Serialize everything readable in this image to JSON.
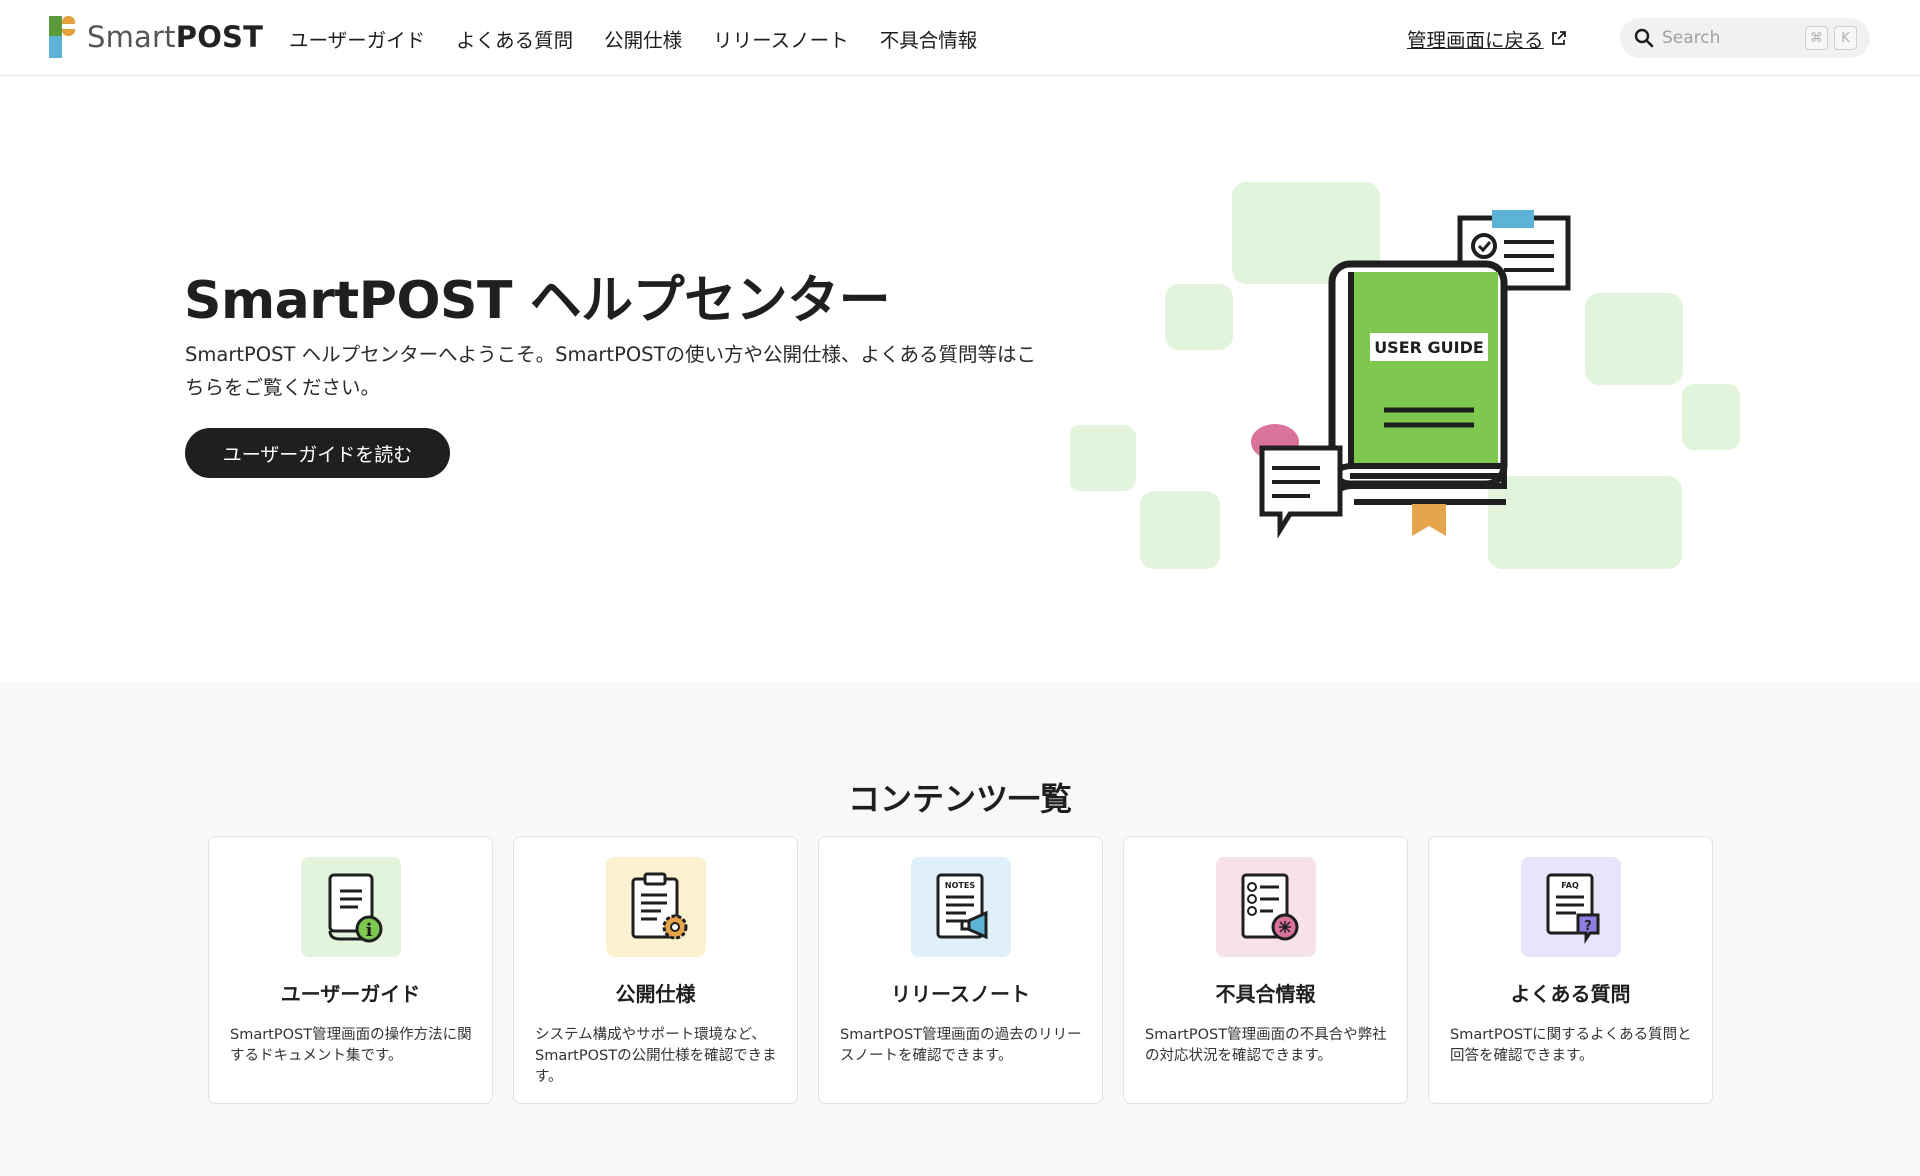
{
  "header": {
    "logo_light": "Smart",
    "logo_bold": "POST",
    "nav": [
      {
        "label": "ユーザーガイド"
      },
      {
        "label": "よくある質問"
      },
      {
        "label": "公開仕様"
      },
      {
        "label": "リリースノート"
      },
      {
        "label": "不具合情報"
      }
    ],
    "admin_link": "管理画面に戻る",
    "search": {
      "placeholder": "Search",
      "shortcut_modifier": "⌘",
      "shortcut_key": "K"
    }
  },
  "hero": {
    "title": "SmartPOST ヘルプセンター",
    "description": "SmartPOST ヘルプセンターへようこそ。SmartPOSTの使い方や公開仕様、よくある質問等はこちらをご覧ください。",
    "button_label": "ユーザーガイドを読む",
    "illustration_text": "USER GUIDE"
  },
  "contents": {
    "title": "コンテンツ一覧",
    "cards": [
      {
        "title": "ユーザーガイド",
        "description": "SmartPOST管理画面の操作方法に関するドキュメント集です。",
        "icon": "user-guide-book-icon",
        "color": "#e3f4dc"
      },
      {
        "title": "公開仕様",
        "description": "システム構成やサポート環境など、SmartPOSTの公開仕様を確認できます。",
        "icon": "spec-clipboard-gear-icon",
        "color": "#fcf2d2"
      },
      {
        "title": "リリースノート",
        "description": "SmartPOST管理画面の過去のリリースノートを確認できます。",
        "icon": "release-notes-megaphone-icon",
        "color": "#dff0fa"
      },
      {
        "title": "不具合情報",
        "description": "SmartPOST管理画面の不具合や弊社の対応状況を確認できます。",
        "icon": "bug-checklist-icon",
        "color": "#f7e1ea"
      },
      {
        "title": "よくある質問",
        "description": "SmartPOSTに関するよくある質問と回答を確認できます。",
        "icon": "faq-question-icon",
        "color": "#e6e5fb"
      }
    ]
  },
  "colors": {
    "accent_green": "#7ec850",
    "dark": "#1f1f1f",
    "section_bg": "#f8f8f8"
  }
}
